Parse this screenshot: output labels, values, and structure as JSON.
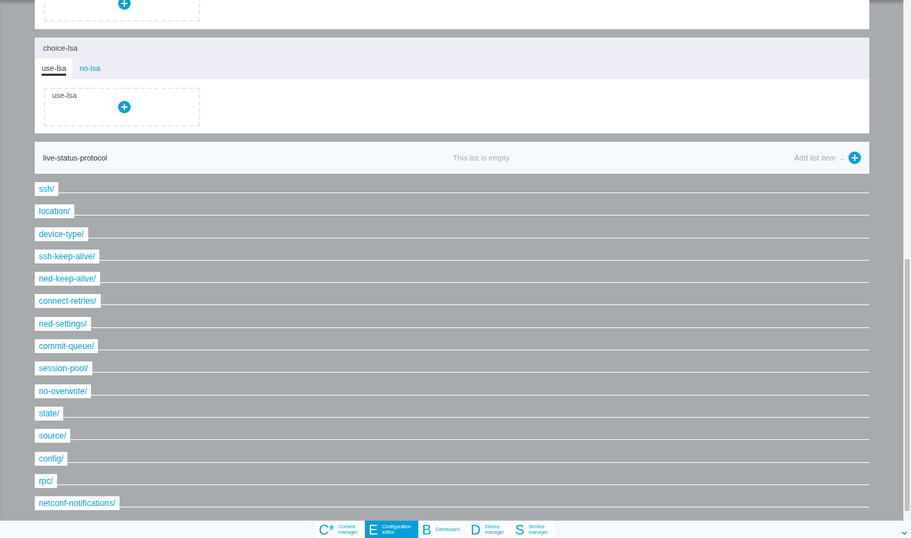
{
  "top_card": {
    "kind": "add-box"
  },
  "choice": {
    "title": "choice-lsa",
    "tabs": [
      {
        "label": "use-lsa",
        "selected": true
      },
      {
        "label": "no-lsa",
        "selected": false
      }
    ],
    "box_label": "use-lsa"
  },
  "list": {
    "name": "live-status-protocol",
    "empty_text": "This list is empty",
    "add_label": "Add list item →"
  },
  "links": [
    "ssh/",
    "location/",
    "device-type/",
    "ssh-keep-alive/",
    "ned-keep-alive/",
    "connect-retries/",
    "ned-settings/",
    "commit-queue/",
    "session-pool/",
    "no-overwrite/",
    "state/",
    "source/",
    "config/",
    "rpc/",
    "netconf-notifications/"
  ],
  "nav": [
    {
      "letter": "C*",
      "label": [
        "Commit",
        "manager"
      ],
      "selected": false
    },
    {
      "letter": "E",
      "label": [
        "Configuration",
        "editor"
      ],
      "selected": true
    },
    {
      "letter": "B",
      "label": [
        "Dashboard"
      ],
      "selected": false
    },
    {
      "letter": "D",
      "label": [
        "Device",
        "manager"
      ],
      "selected": false
    },
    {
      "letter": "S",
      "label": [
        "Service",
        "manager"
      ],
      "selected": false
    }
  ]
}
